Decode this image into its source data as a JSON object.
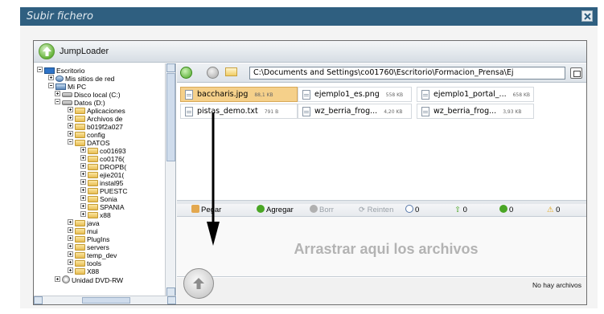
{
  "window": {
    "title": "Subir fichero"
  },
  "app": {
    "name": "JumpLoader"
  },
  "tree": [
    {
      "label": "Escritorio",
      "icon": "desktop-icon",
      "toggle": "minus"
    },
    {
      "label": "Mis sitios de red",
      "icon": "network-icon",
      "toggle": "plus"
    },
    {
      "label": "Mi PC",
      "icon": "computer-icon",
      "toggle": "minus"
    },
    {
      "label": "Disco local (C:)",
      "icon": "disk-icon",
      "toggle": "plus"
    },
    {
      "label": "Datos (D:)",
      "icon": "disk-icon",
      "toggle": "minus"
    },
    {
      "label": "Aplicaciones",
      "icon": "folder-icon",
      "toggle": "plus"
    },
    {
      "label": "Archivos de",
      "icon": "folder-icon",
      "toggle": "plus"
    },
    {
      "label": "b019f2a027",
      "icon": "folder-icon",
      "toggle": "plus"
    },
    {
      "label": "config",
      "icon": "folder-icon",
      "toggle": "plus"
    },
    {
      "label": "DATOS",
      "icon": "folder-icon",
      "toggle": "minus"
    },
    {
      "label": "co01693",
      "icon": "folder-icon",
      "toggle": "plus"
    },
    {
      "label": "co0176(",
      "icon": "folder-icon",
      "toggle": "plus"
    },
    {
      "label": "DROPB(",
      "icon": "folder-icon",
      "toggle": "plus"
    },
    {
      "label": "ejie201(",
      "icon": "folder-icon",
      "toggle": "plus"
    },
    {
      "label": "instal95",
      "icon": "folder-icon",
      "toggle": "plus"
    },
    {
      "label": "PUESTC",
      "icon": "folder-icon",
      "toggle": "plus"
    },
    {
      "label": "Sonia",
      "icon": "folder-icon",
      "toggle": "plus"
    },
    {
      "label": "SPANIA",
      "icon": "folder-icon",
      "toggle": "plus"
    },
    {
      "label": "x88",
      "icon": "folder-icon",
      "toggle": "plus"
    },
    {
      "label": "java",
      "icon": "folder-icon",
      "toggle": "plus"
    },
    {
      "label": "mui",
      "icon": "folder-icon",
      "toggle": "plus"
    },
    {
      "label": "PlugIns",
      "icon": "folder-icon",
      "toggle": "plus"
    },
    {
      "label": "servers",
      "icon": "folder-icon",
      "toggle": "plus"
    },
    {
      "label": "temp_dev",
      "icon": "folder-icon",
      "toggle": "plus"
    },
    {
      "label": "tools",
      "icon": "folder-icon",
      "toggle": "plus"
    },
    {
      "label": "X88",
      "icon": "folder-icon",
      "toggle": "plus"
    },
    {
      "label": "Unidad DVD-RW",
      "icon": "dvd-icon",
      "toggle": "plus"
    }
  ],
  "path": {
    "value": "C:\\Documents and Settings\\co01760\\Escritorio\\Formacion_Prensa\\Ej"
  },
  "files": [
    {
      "name": "baccharis.jpg",
      "size": "88,1 KB",
      "selected": true
    },
    {
      "name": "ejemplo1_es.png",
      "size": "558 KB",
      "selected": false
    },
    {
      "name": "ejemplo1_portal_...",
      "size": "658 KB",
      "selected": false
    },
    {
      "name": "pistas_demo.txt",
      "size": "791 B",
      "selected": false
    },
    {
      "name": "wz_berria_frog...",
      "size": "4,20 KB",
      "selected": false
    },
    {
      "name": "wz_berria_frog...",
      "size": "3,93 KB",
      "selected": false
    }
  ],
  "actions": {
    "pegar": "Pegar",
    "agregar": "Agregar",
    "borrar": "Borr",
    "reintentar": "Reinten",
    "pending_count": "0",
    "upload_count": "0",
    "ok_count": "0",
    "warn_count": "0"
  },
  "drop": {
    "text": "Arrastrar aqui los archivos"
  },
  "status": {
    "text": "No hay archivos"
  },
  "colors": {
    "titlebar": "#2f5f80",
    "selected_file": "#f5d08a",
    "accent_green": "#4aa625"
  }
}
